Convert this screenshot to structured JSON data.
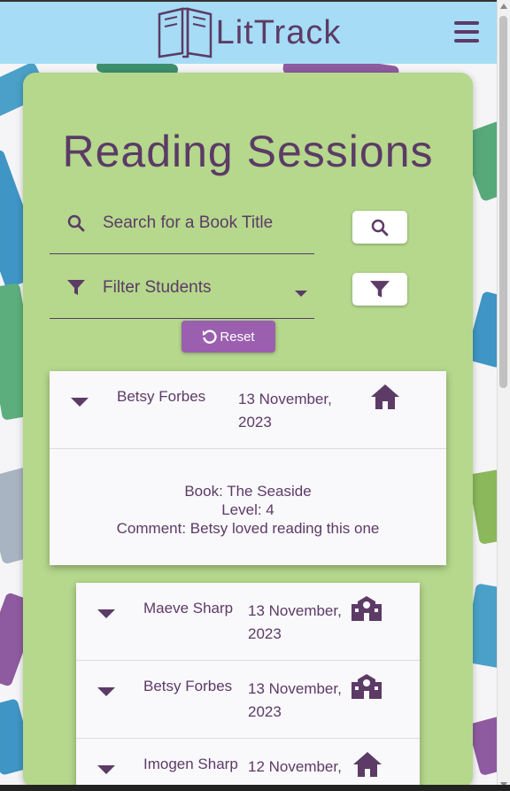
{
  "app": {
    "brand": "LitTrack"
  },
  "page": {
    "title": "Reading Sessions"
  },
  "search": {
    "placeholder": "Search for a Book Title"
  },
  "filter": {
    "label": "Filter Students"
  },
  "buttons": {
    "reset": "Reset"
  },
  "expanded_session": {
    "student": "Betsy Forbes",
    "date": "13 November, 2023",
    "place_icon": "home-icon",
    "book": "Book: The Seaside",
    "level": "Level: 4",
    "comment": "Comment: Betsy loved reading this one"
  },
  "sessions": [
    {
      "student": "Maeve Sharp",
      "date": "13 November, 2023",
      "place_icon": "school-icon"
    },
    {
      "student": "Betsy Forbes",
      "date": "13 November, 2023",
      "place_icon": "school-icon"
    },
    {
      "student": "Imogen Sharp",
      "date": "12 November,",
      "place_icon": "home-icon"
    }
  ],
  "colors": {
    "navbar": "#a6dcf5",
    "panel": "#b5d88c",
    "accent": "#5c3b66",
    "reset": "#9b5fb0"
  }
}
